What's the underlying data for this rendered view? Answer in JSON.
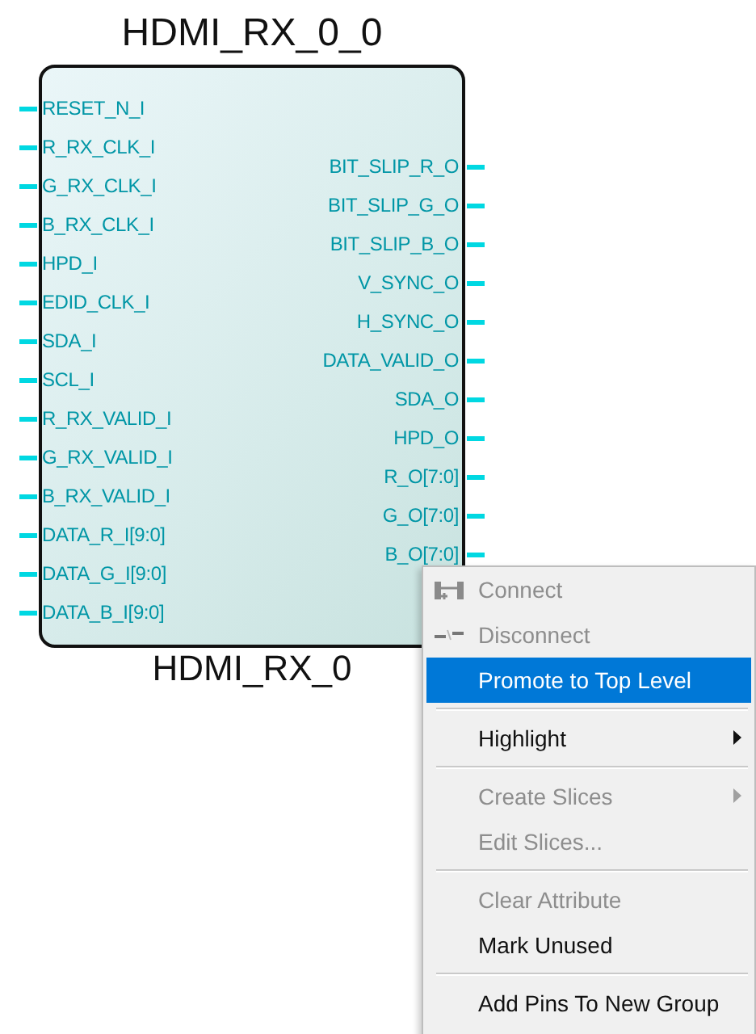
{
  "block": {
    "instance_name": "HDMI_RX_0_0",
    "cell_name": "HDMI_RX_0",
    "input_pins": [
      "RESET_N_I",
      "R_RX_CLK_I",
      "G_RX_CLK_I",
      "B_RX_CLK_I",
      "HPD_I",
      "EDID_CLK_I",
      "SDA_I",
      "SCL_I",
      "R_RX_VALID_I",
      "G_RX_VALID_I",
      "B_RX_VALID_I",
      "DATA_R_I[9:0]",
      "DATA_G_I[9:0]",
      "DATA_B_I[9:0]"
    ],
    "output_pins": [
      "BIT_SLIP_R_O",
      "BIT_SLIP_G_O",
      "BIT_SLIP_B_O",
      "V_SYNC_O",
      "H_SYNC_O",
      "DATA_VALID_O",
      "SDA_O",
      "HPD_O",
      "R_O[7:0]",
      "G_O[7:0]",
      "B_O[7:0]"
    ]
  },
  "context_menu": {
    "items": [
      {
        "kind": "item",
        "label": "Connect",
        "disabled": true,
        "selected": false,
        "submenu": false
      },
      {
        "kind": "item",
        "label": "Disconnect",
        "disabled": true,
        "selected": false,
        "submenu": false
      },
      {
        "kind": "item",
        "label": "Promote to Top Level",
        "disabled": false,
        "selected": true,
        "submenu": false
      },
      {
        "kind": "separator"
      },
      {
        "kind": "item",
        "label": "Highlight",
        "disabled": false,
        "selected": false,
        "submenu": true
      },
      {
        "kind": "separator"
      },
      {
        "kind": "item",
        "label": "Create Slices",
        "disabled": true,
        "selected": false,
        "submenu": true
      },
      {
        "kind": "item",
        "label": "Edit Slices...",
        "disabled": true,
        "selected": false,
        "submenu": false
      },
      {
        "kind": "separator"
      },
      {
        "kind": "item",
        "label": "Clear Attribute",
        "disabled": true,
        "selected": false,
        "submenu": false
      },
      {
        "kind": "item",
        "label": "Mark Unused",
        "disabled": false,
        "selected": false,
        "submenu": false
      },
      {
        "kind": "separator"
      },
      {
        "kind": "item",
        "label": "Add Pins To New Group",
        "disabled": false,
        "selected": false,
        "submenu": false
      }
    ]
  }
}
